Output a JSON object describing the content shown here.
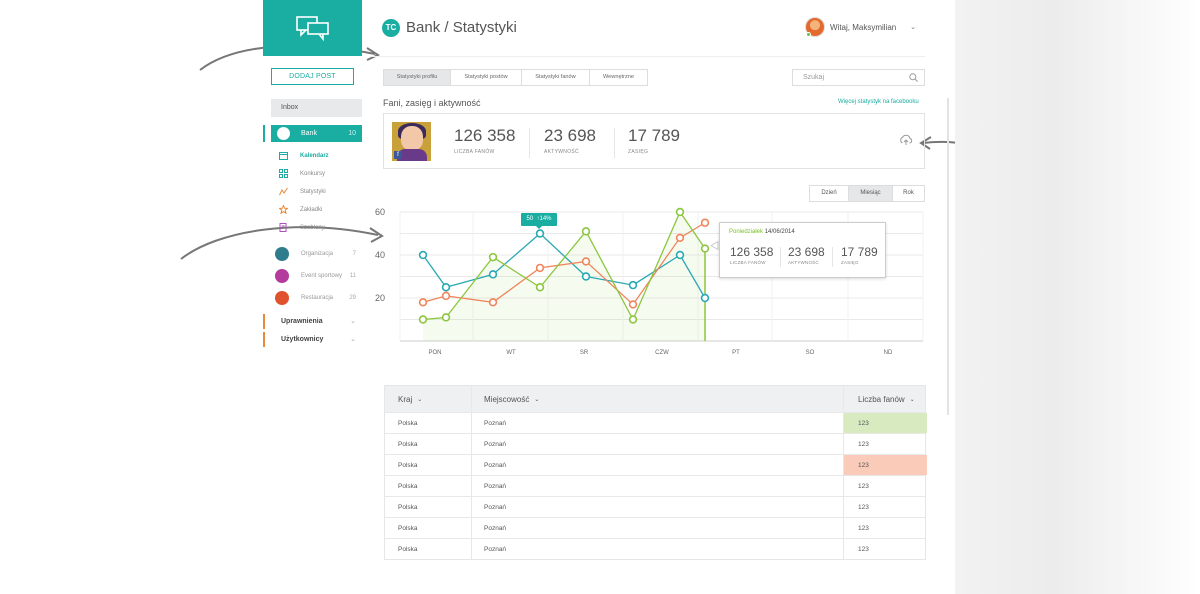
{
  "colors": {
    "accent": "#1aada1",
    "green": "#8cc63f",
    "orange": "#f0845a",
    "teal_line": "#2aa8b4"
  },
  "sidebar": {
    "add_post": "DODAJ POST",
    "inbox": "Inbox",
    "bank": {
      "label": "Bank",
      "count": "10"
    },
    "sub_items": [
      {
        "label": "Kalendarz",
        "icon": "calendar-icon"
      },
      {
        "label": "Konkursy",
        "icon": "grid-icon"
      },
      {
        "label": "Statystyki",
        "icon": "chart-icon"
      },
      {
        "label": "Zakładki",
        "icon": "star-icon"
      },
      {
        "label": "Szablony",
        "icon": "template-icon"
      }
    ],
    "pages": [
      {
        "label": "Organizacja",
        "count": "7"
      },
      {
        "label": "Event sportowy",
        "count": "11"
      },
      {
        "label": "Restauracja",
        "count": "29"
      }
    ],
    "sections": [
      {
        "label": "Uprawnienia"
      },
      {
        "label": "Użytkownicy"
      }
    ]
  },
  "header": {
    "logo_text": "TC",
    "title": "Bank / Statystyki",
    "user": "Witaj, Maksymilian"
  },
  "tabs": [
    "Statystyki profilu",
    "Statystyki postów",
    "Statystyki fanów",
    "Wewnętrzne"
  ],
  "search": {
    "placeholder": "Szukaj"
  },
  "section_title": "Fani, zasięg i aktywność",
  "fb_link": "Więcej statystyk na facebooku",
  "stats": [
    {
      "value": "126 358",
      "label": "LICZBA FANÓW"
    },
    {
      "value": "23 698",
      "label": "AKTYWNOŚĆ"
    },
    {
      "value": "17 789",
      "label": "ZASIĘG"
    }
  ],
  "period_buttons": [
    "Dzień",
    "Miesiąc",
    "Rok"
  ],
  "peak_badge": {
    "value": "50",
    "change": "14%"
  },
  "tooltip": {
    "day": "Poniedziałek",
    "date": "14/06/2014",
    "stats": [
      {
        "value": "126 358",
        "label": "LICZBA FANÓW"
      },
      {
        "value": "23 698",
        "label": "AKTYWNOŚĆ"
      },
      {
        "value": "17 789",
        "label": "ZASIĘG"
      }
    ]
  },
  "chart_data": {
    "type": "line",
    "x": [
      "PON",
      "",
      "",
      "WT",
      "",
      "SR",
      "",
      "CZW",
      "",
      "",
      "",
      "PT"
    ],
    "x_tick_labels": [
      "PON",
      "WT",
      "SR",
      "CZW",
      "PT",
      "SO",
      "ND"
    ],
    "y_ticks": [
      60,
      40,
      20
    ],
    "ylim": [
      0,
      60
    ],
    "series": [
      {
        "color": "#2aa8b4",
        "values": [
          40,
          25,
          31,
          50,
          30,
          26,
          40,
          20
        ]
      },
      {
        "color": "#f0845a",
        "values": [
          18,
          21,
          18,
          34,
          37,
          17,
          48,
          55
        ]
      },
      {
        "color": "#8cc63f",
        "values": [
          10,
          11,
          39,
          25,
          51,
          10,
          60,
          43
        ]
      }
    ]
  },
  "table": {
    "headers": [
      "Kraj",
      "Miejscowość",
      "Liczba fanów"
    ],
    "rows": [
      [
        "Polska",
        "Poznań",
        "123"
      ],
      [
        "Polska",
        "Poznań",
        "123"
      ],
      [
        "Polska",
        "Poznań",
        "123"
      ],
      [
        "Polska",
        "Poznań",
        "123"
      ],
      [
        "Polska",
        "Poznań",
        "123"
      ],
      [
        "Polska",
        "Poznań",
        "123"
      ],
      [
        "Polska",
        "Poznań",
        "123"
      ]
    ],
    "highlight": [
      "#d8ebc0",
      "",
      "#f9cbb8",
      "",
      "",
      "",
      ""
    ]
  }
}
